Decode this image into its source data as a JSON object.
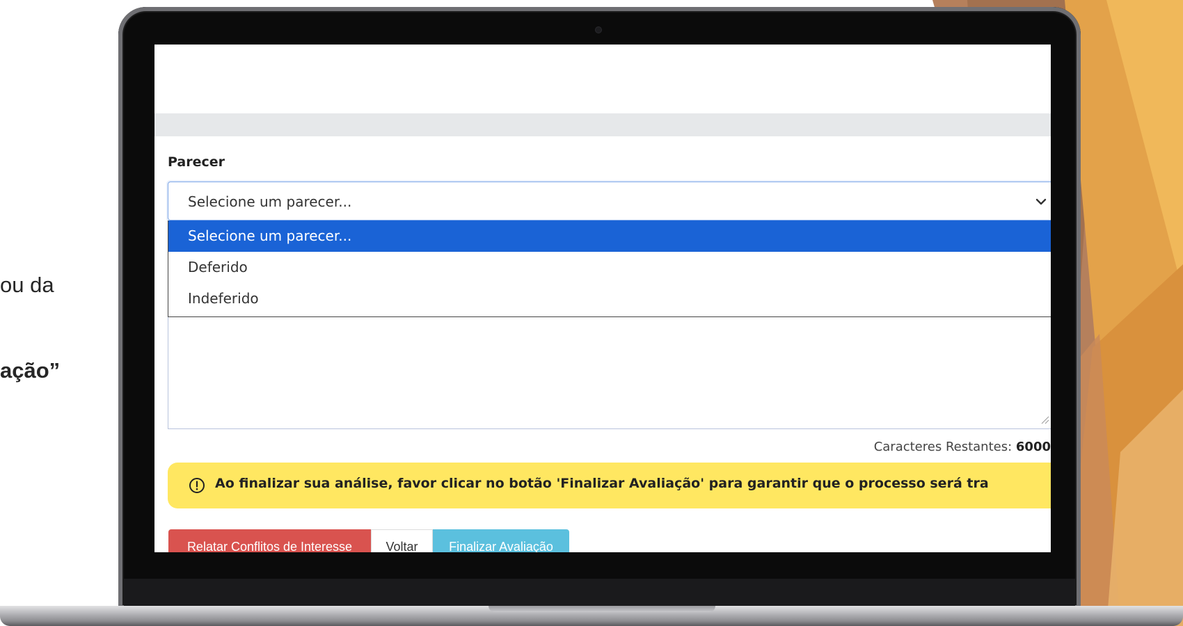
{
  "slide": {
    "fragment_1": "ou da",
    "fragment_2": "ação”"
  },
  "form": {
    "parecer_label": "Parecer",
    "select_value": "Selecione um parecer...",
    "options": [
      {
        "label": "Selecione um parecer...",
        "selected": true
      },
      {
        "label": "Deferido",
        "selected": false
      },
      {
        "label": "Indeferido",
        "selected": false
      }
    ],
    "chars_label": "Caracteres Restantes: ",
    "chars_value": "6000"
  },
  "alert": {
    "icon": "exclamation-circle-icon",
    "text": "Ao finalizar sua análise, favor clicar no botão 'Finalizar Avaliação' para garantir que o processo será tra"
  },
  "buttons": {
    "conflitos": "Relatar Conflitos de Interesse",
    "voltar": "Voltar",
    "finalizar": "Finalizar Avaliação"
  },
  "colors": {
    "selected_option": "#1a63d6",
    "alert_bg": "#ffe761",
    "danger": "#d9534f",
    "info": "#5bc0de"
  }
}
